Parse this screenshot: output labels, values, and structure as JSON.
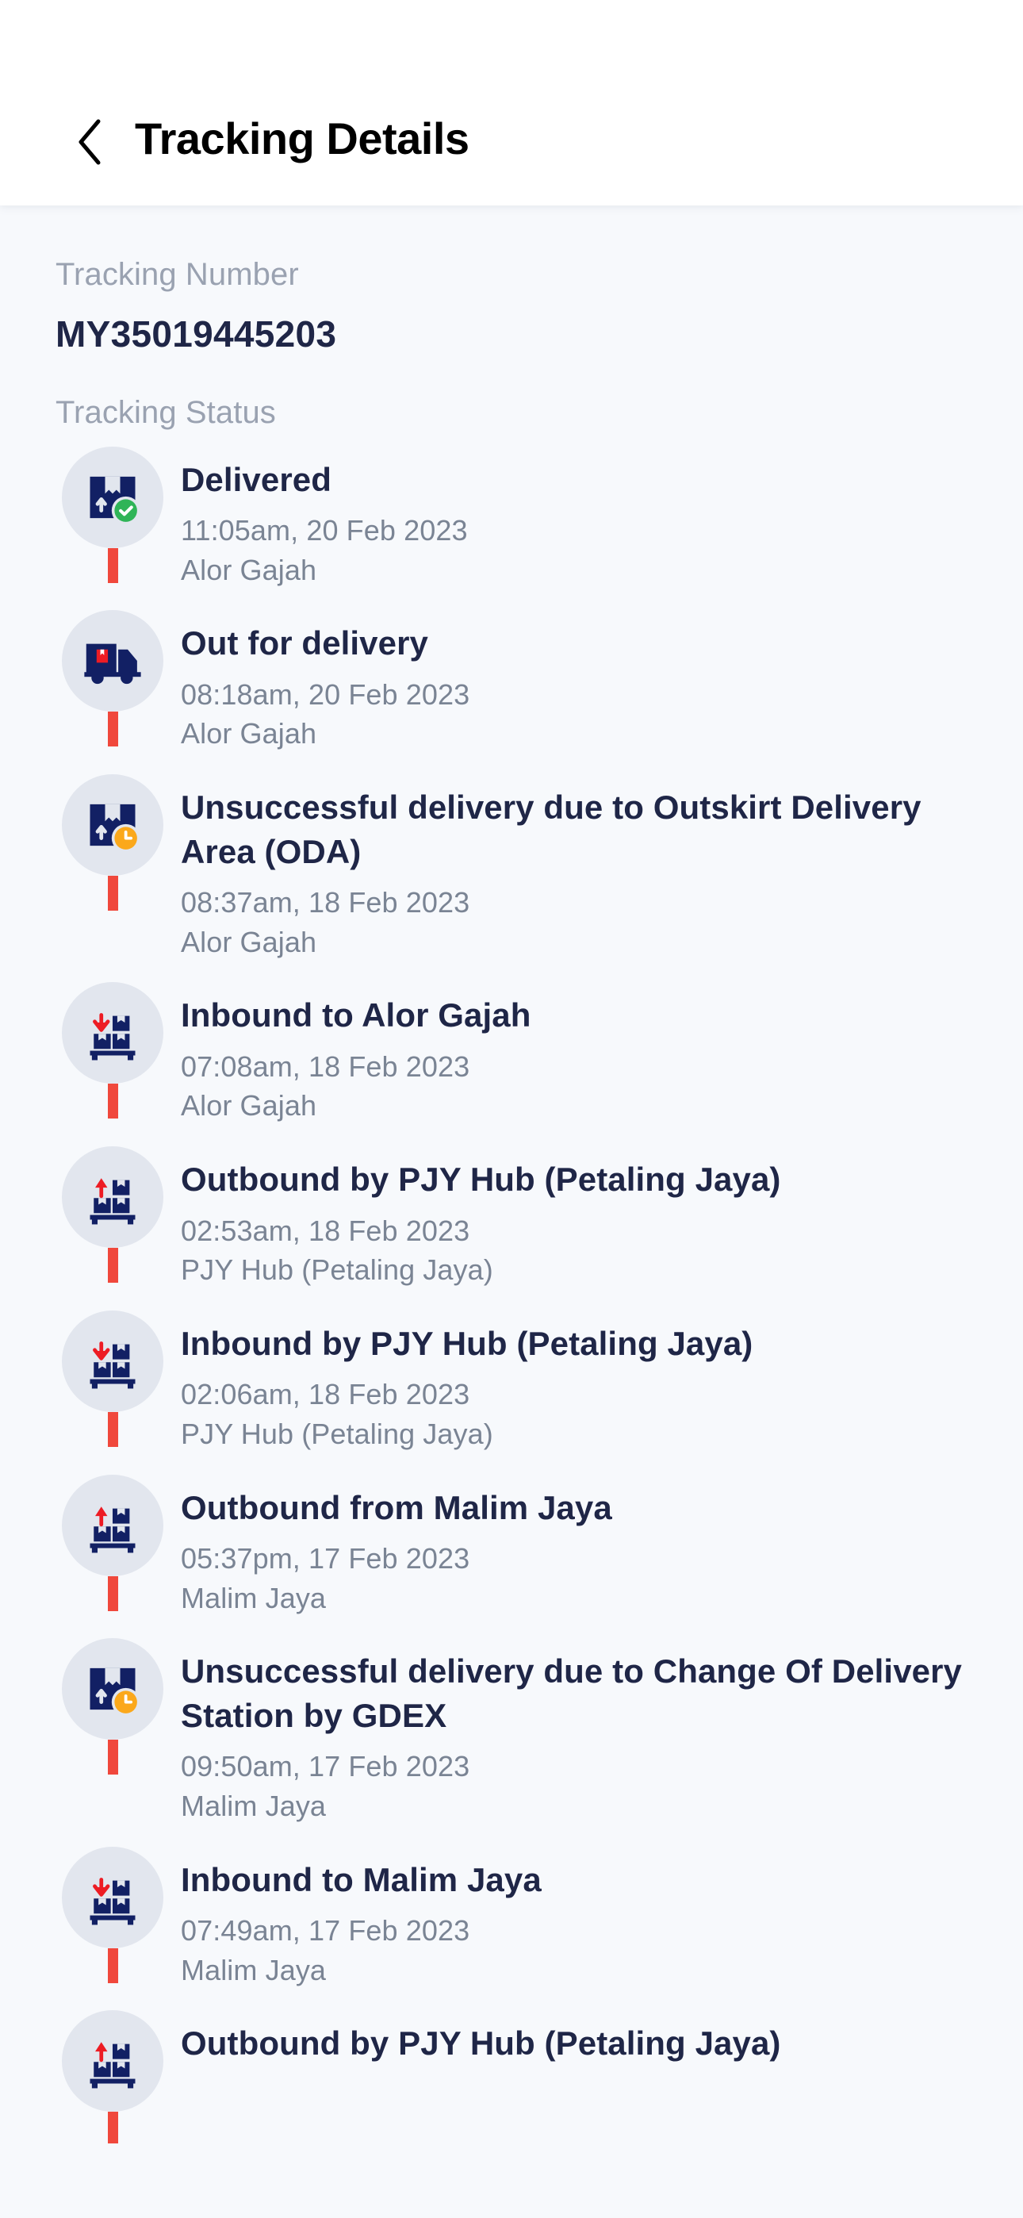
{
  "header": {
    "back_icon": "chevron-left-icon",
    "title": "Tracking Details"
  },
  "tracking": {
    "number_label": "Tracking Number",
    "number_value": "MY35019445203",
    "status_label": "Tracking Status"
  },
  "colors": {
    "timeline_line": "#F0483C",
    "badge_bg": "#E2E6EE",
    "icon_navy": "#122064",
    "accent_green": "#2FB457",
    "accent_orange": "#FBA81B",
    "accent_red": "#ED1C24",
    "title_text": "#1F2647",
    "muted_text": "#7A8494",
    "label_text": "#9AA2B1",
    "page_bg": "#F7F9FC"
  },
  "events": [
    {
      "icon": "package-check-icon",
      "title": "Delivered",
      "datetime": "11:05am, 20 Feb 2023",
      "location": "Alor Gajah"
    },
    {
      "icon": "delivery-truck-icon",
      "title": "Out for delivery",
      "datetime": "08:18am, 20 Feb 2023",
      "location": "Alor Gajah"
    },
    {
      "icon": "package-clock-icon",
      "title": "Unsuccessful delivery due to Outskirt Delivery Area (ODA)",
      "datetime": "08:37am, 18 Feb 2023",
      "location": "Alor Gajah"
    },
    {
      "icon": "warehouse-inbound-icon",
      "title": "Inbound to Alor Gajah",
      "datetime": "07:08am, 18 Feb 2023",
      "location": "Alor Gajah"
    },
    {
      "icon": "warehouse-outbound-icon",
      "title": "Outbound by PJY Hub (Petaling Jaya)",
      "datetime": "02:53am, 18 Feb 2023",
      "location": "PJY Hub (Petaling Jaya)"
    },
    {
      "icon": "warehouse-inbound-icon",
      "title": "Inbound by PJY Hub (Petaling Jaya)",
      "datetime": "02:06am, 18 Feb 2023",
      "location": "PJY Hub (Petaling Jaya)"
    },
    {
      "icon": "warehouse-outbound-icon",
      "title": "Outbound from Malim Jaya",
      "datetime": "05:37pm, 17 Feb 2023",
      "location": "Malim Jaya"
    },
    {
      "icon": "package-clock-icon",
      "title": "Unsuccessful delivery due to Change Of Delivery Station by GDEX",
      "datetime": "09:50am, 17 Feb 2023",
      "location": "Malim Jaya"
    },
    {
      "icon": "warehouse-inbound-icon",
      "title": "Inbound to Malim Jaya",
      "datetime": "07:49am, 17 Feb 2023",
      "location": "Malim Jaya"
    },
    {
      "icon": "warehouse-outbound-icon",
      "title": "Outbound by PJY Hub (Petaling Jaya)",
      "datetime": "",
      "location": ""
    }
  ]
}
